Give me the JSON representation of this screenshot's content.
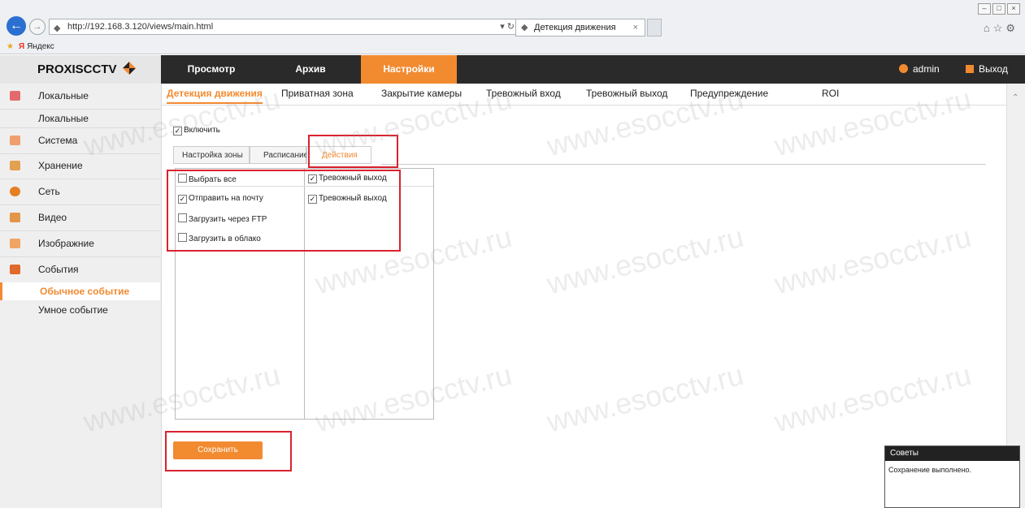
{
  "browser": {
    "url": "http://192.168.3.120/views/main.html",
    "tab_title": "Детекция движения",
    "favorite": "Яндекс"
  },
  "app": {
    "logo": "PROXISCCTV",
    "nav": [
      "Просмотр",
      "Архив",
      "Настройки"
    ],
    "active_nav": "Настройки",
    "user": "admin",
    "logout": "Выход"
  },
  "sidebar": {
    "items": [
      {
        "label": "Локальные",
        "icon": "monitor-icon"
      },
      {
        "label": "Система",
        "icon": "system-icon"
      },
      {
        "label": "Хранение",
        "icon": "storage-icon"
      },
      {
        "label": "Сеть",
        "icon": "network-icon"
      },
      {
        "label": "Видео",
        "icon": "video-icon"
      },
      {
        "label": "Изображние",
        "icon": "image-icon"
      },
      {
        "label": "События",
        "icon": "events-icon"
      }
    ],
    "sub_local": "Локальные",
    "sub_events_active": "Обычное событие",
    "sub_events_smart": "Умное событие"
  },
  "subnav": {
    "tabs": [
      "Детекция движения",
      "Приватная зона",
      "Закрытие камеры",
      "Тревожный вход",
      "Тревожный выход",
      "Предупреждение",
      "ROI"
    ],
    "active": "Детекция движения"
  },
  "settings": {
    "enable_label": "Включить",
    "enable_checked": true,
    "crumbs": [
      "Настройка зоны",
      "Расписание",
      "Действия"
    ],
    "active_crumb": "Действия",
    "left_column": [
      {
        "label": "Выбрать все",
        "checked": false
      },
      {
        "label": "Отправить на почту",
        "checked": true
      },
      {
        "label": "Загрузить через FTP",
        "checked": false
      },
      {
        "label": "Загрузить в облако",
        "checked": false
      }
    ],
    "right_column": [
      {
        "label": "Тревожный выход",
        "checked": true
      },
      {
        "label": "Тревожный выход",
        "checked": true
      }
    ],
    "save_label": "Сохранить"
  },
  "tips": {
    "title": "Советы",
    "message": "Сохранение выполнено."
  },
  "watermark": "www.esocctv.ru",
  "colors": {
    "accent": "#f28a30",
    "topbar": "#2a2a2a",
    "highlight": "#d9232e"
  }
}
